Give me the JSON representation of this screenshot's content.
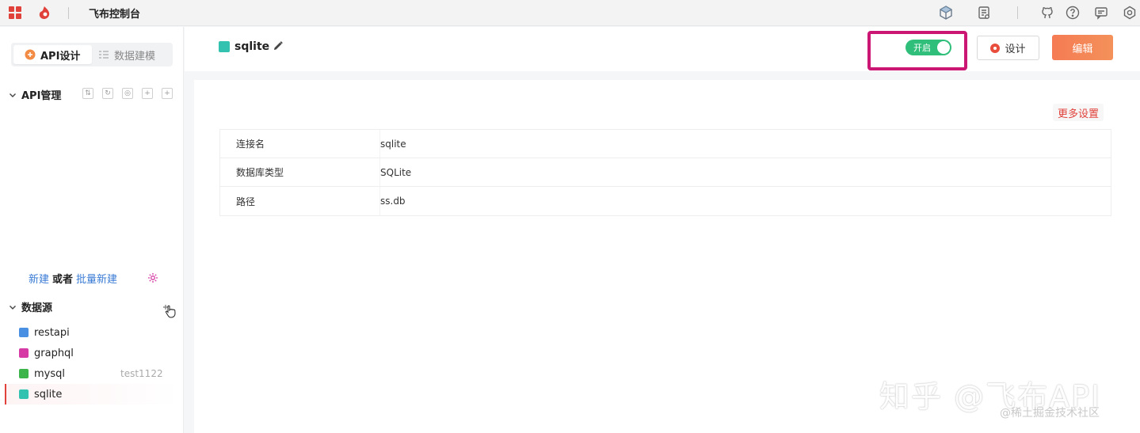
{
  "topbar": {
    "title": "飞布控制台",
    "icons": [
      "apps-grid-icon",
      "feibu-logo-icon",
      "cube-icon",
      "document-icon",
      "github-icon",
      "help-icon",
      "message-icon",
      "settings-icon"
    ]
  },
  "sidebar": {
    "modes": [
      {
        "label": "API设计",
        "active": true
      },
      {
        "label": "数据建模",
        "active": false
      }
    ],
    "api_section": {
      "title": "API管理",
      "tools": [
        "⇅",
        "↻",
        "◎",
        "+",
        "+"
      ]
    },
    "create": {
      "new": "新建",
      "or": "或者",
      "batch": "批量新建"
    },
    "datasource_section": {
      "title": "数据源",
      "items": [
        {
          "name": "restapi",
          "color": "#4a90e2",
          "tag": ""
        },
        {
          "name": "graphql",
          "color": "#d63aa4",
          "tag": ""
        },
        {
          "name": "mysql",
          "color": "#3bb44a",
          "tag": "test1122"
        },
        {
          "name": "sqlite",
          "color": "#33c2b0",
          "tag": "",
          "selected": true
        }
      ]
    }
  },
  "main": {
    "header": {
      "connection_name": "sqlite",
      "toggle": {
        "label": "开启",
        "on": true
      },
      "design_label": "设计",
      "edit_label": "编辑"
    },
    "more_settings": "更多设置",
    "details": [
      {
        "key": "连接名",
        "value": "sqlite"
      },
      {
        "key": "数据库类型",
        "value": "SQLite"
      },
      {
        "key": "路径",
        "value": "ss.db"
      }
    ]
  },
  "watermark": {
    "main": "知乎 @飞布API",
    "sub": "@稀土掘金技术社区"
  },
  "colors": {
    "accent": "#e0423b",
    "toggle_on": "#2fbf7a",
    "highlight": "#cc1673",
    "edit_button": "#f57b54"
  }
}
